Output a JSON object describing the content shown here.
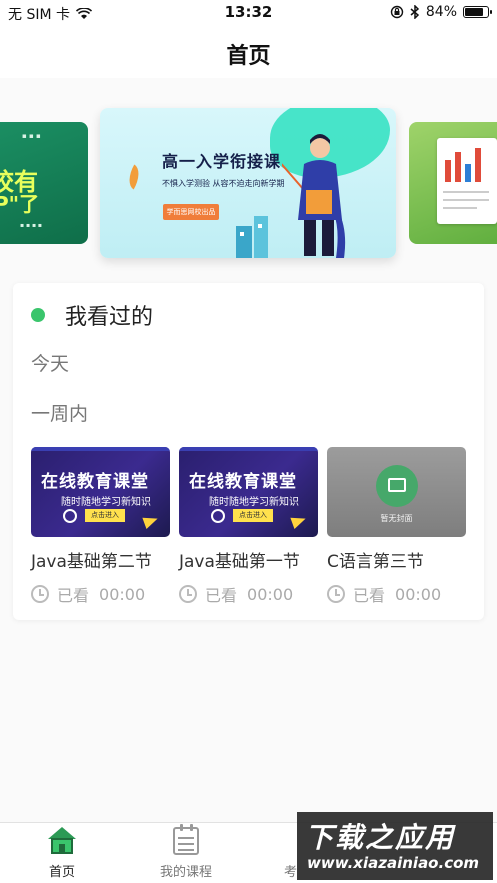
{
  "status_bar": {
    "carrier": "无 SIM 卡",
    "time": "13:32",
    "battery_percent": "84%",
    "battery_level": 0.84
  },
  "nav": {
    "title": "首页"
  },
  "banners": {
    "left": {
      "big_text": "校有",
      "big_text_2": "P\"了"
    },
    "main": {
      "title": "高一入学衔接课",
      "subtitle": "不惧入学测验 从容不迫走向新学期",
      "button": "学而思网校出品"
    }
  },
  "history": {
    "title": "我看过的",
    "today_label": "今天",
    "week_label": "一周内",
    "courses": [
      {
        "title": "Java基础第二节",
        "watched_label": "已看",
        "watched_time": "00:00",
        "thumb": {
          "headline": "在线教育课堂",
          "tagline": "随时随地学习新知识",
          "button": "点击进入"
        }
      },
      {
        "title": "Java基础第一节",
        "watched_label": "已看",
        "watched_time": "00:00",
        "thumb": {
          "headline": "在线教育课堂",
          "tagline": "随时随地学习新知识",
          "button": "点击进入"
        }
      },
      {
        "title": "C语言第三节",
        "watched_label": "已看",
        "watched_time": "00:00",
        "thumb": {
          "placeholder": "暂无封面"
        }
      }
    ]
  },
  "tabs": [
    {
      "label": "首页",
      "active": true
    },
    {
      "label": "我的课程",
      "active": false
    },
    {
      "label": "考",
      "active": false
    }
  ],
  "watermark": {
    "cn": "下载之应用",
    "en": "www.xiazainiao.com"
  },
  "colors": {
    "accent_green": "#3ac56c",
    "background": "#fafafa",
    "card": "#ffffff"
  }
}
